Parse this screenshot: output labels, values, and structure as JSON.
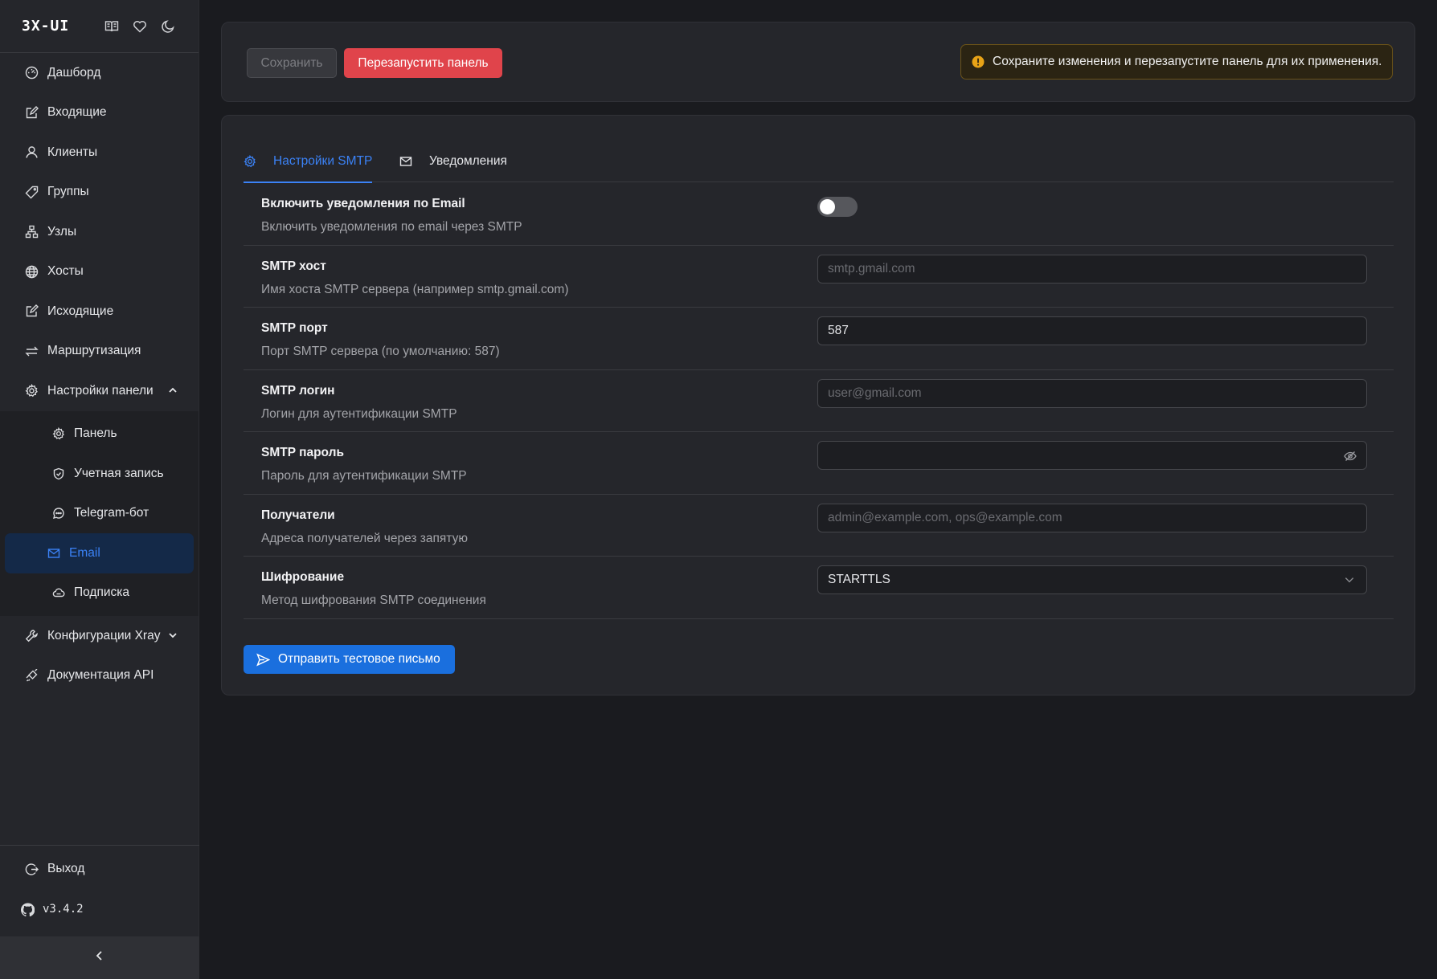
{
  "brand": {
    "title": "3X-UI"
  },
  "sidebar": {
    "items": [
      {
        "label": "Дашборд",
        "icon": "dashboard-icon"
      },
      {
        "label": "Входящие",
        "icon": "edit-icon"
      },
      {
        "label": "Клиенты",
        "icon": "user-icon"
      },
      {
        "label": "Группы",
        "icon": "tag-icon"
      },
      {
        "label": "Узлы",
        "icon": "cluster-icon"
      },
      {
        "label": "Хосты",
        "icon": "globe-icon"
      },
      {
        "label": "Исходящие",
        "icon": "edit-icon"
      },
      {
        "label": "Маршрутизация",
        "icon": "swap-icon"
      },
      {
        "label": "Настройки панели",
        "icon": "gear-icon"
      }
    ],
    "submenu": [
      {
        "label": "Панель",
        "icon": "gear-icon"
      },
      {
        "label": "Учетная запись",
        "icon": "shield-icon"
      },
      {
        "label": "Telegram-бот",
        "icon": "chat-icon"
      },
      {
        "label": "Email",
        "icon": "mail-icon"
      },
      {
        "label": "Подписка",
        "icon": "cloud-icon"
      }
    ],
    "after": [
      {
        "label": "Конфигурации Xray",
        "icon": "tool-icon"
      },
      {
        "label": "Документация API",
        "icon": "api-icon"
      }
    ],
    "logout_label": "Выход",
    "version": "v3.4.2"
  },
  "toolbar": {
    "save_label": "Сохранить",
    "restart_label": "Перезапустить панель",
    "alert_text": "Сохраните изменения и перезапустите панель для их применения."
  },
  "tabs": [
    {
      "label": "Настройки SMTP",
      "active": true
    },
    {
      "label": "Уведомления",
      "active": false
    }
  ],
  "settings": {
    "enable": {
      "title": "Включить уведомления по Email",
      "desc": "Включить уведомления по email через SMTP",
      "enabled": false
    },
    "host": {
      "title": "SMTP хост",
      "desc": "Имя хоста SMTP сервера (например smtp.gmail.com)",
      "placeholder": "smtp.gmail.com",
      "value": ""
    },
    "port": {
      "title": "SMTP порт",
      "desc": "Порт SMTP сервера (по умолчанию: 587)",
      "value": "587"
    },
    "login": {
      "title": "SMTP логин",
      "desc": "Логин для аутентификации SMTP",
      "placeholder": "user@gmail.com",
      "value": ""
    },
    "password": {
      "title": "SMTP пароль",
      "desc": "Пароль для аутентификации SMTP",
      "value": ""
    },
    "recipients": {
      "title": "Получатели",
      "desc": "Адреса получателей через запятую",
      "placeholder": "admin@example.com, ops@example.com",
      "value": ""
    },
    "encryption": {
      "title": "Шифрование",
      "desc": "Метод шифрования SMTP соединения",
      "value": "STARTTLS"
    }
  },
  "test_button_label": "Отправить тестовое письмо",
  "colors": {
    "accent": "#3b82f6",
    "danger": "#e0444b",
    "warning": "#e8a317",
    "background": "#1a1b1f",
    "panel": "#25262b"
  }
}
